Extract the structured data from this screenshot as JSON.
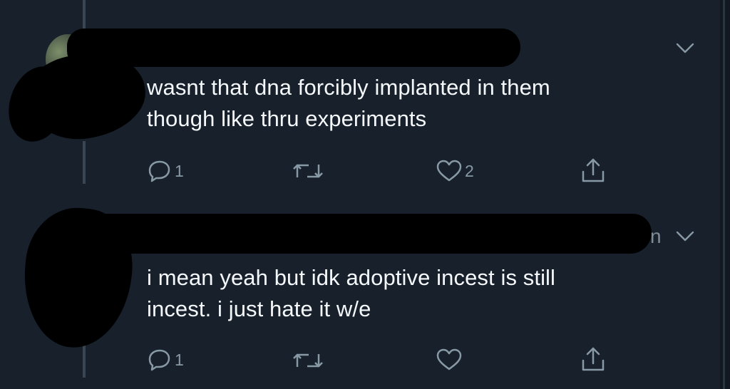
{
  "tweets": [
    {
      "text_lines": [
        "wasnt that dna forcibly implanted in them",
        "though like thru experiments"
      ],
      "actions": {
        "reply_count": "1",
        "retweet_count": "",
        "like_count": "2"
      },
      "icons": [
        "reply-icon",
        "retweet-icon",
        "like-icon",
        "share-icon",
        "chevron-down-icon"
      ]
    },
    {
      "text_lines": [
        "i mean yeah but idk adoptive incest is still",
        "incest. i just hate it w/e"
      ],
      "actions": {
        "reply_count": "1",
        "retweet_count": "",
        "like_count": ""
      },
      "handle_fragment": "n",
      "icons": [
        "reply-icon",
        "retweet-icon",
        "like-icon",
        "share-icon",
        "chevron-down-icon"
      ]
    }
  ],
  "colors": {
    "background": "#17202b",
    "text": "#f5f8fa",
    "icon": "#8899a6",
    "thread_line": "#394552"
  }
}
